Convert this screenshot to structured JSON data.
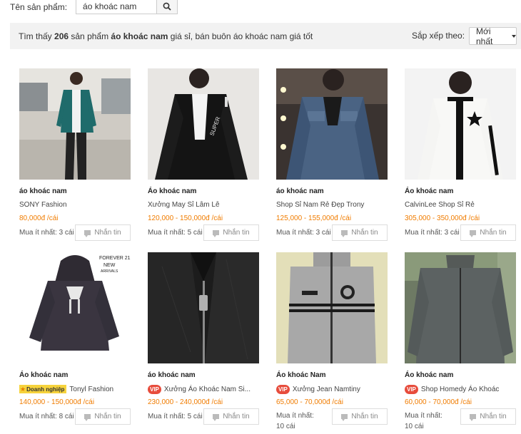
{
  "search": {
    "label": "Tên sản phẩm:",
    "value": "áo khoác nam"
  },
  "result": {
    "prefix": "Tìm thấy ",
    "count": "206",
    "middle": " sản phẩm ",
    "keyword": "áo khoác nam",
    "suffix": " giá sỉ, bán buôn áo khoác nam giá tốt"
  },
  "sort": {
    "label": "Sắp xếp theo:",
    "selected": "Mới nhất"
  },
  "message_label": "Nhắn tin",
  "products": [
    {
      "title": "áo khoác nam",
      "shop": "SONY Fashion",
      "price": "80,000đ",
      "unit": " /cái",
      "min": "Mua ít nhất: 3 cái",
      "colors": {
        "bg": "#c9c4bb",
        "coat": "#1f6b6b"
      }
    },
    {
      "title": "Áo khoác nam",
      "shop": "Xưởng May Sỉ Lâm Lê",
      "price": "120,000 - 150,000đ",
      "unit": " /cái",
      "min": "Mua ít nhất: 5 cái"
    },
    {
      "title": "áo khoác nam",
      "shop": "Shop Sỉ Nam Rẻ Đẹp Trony",
      "price": "125,000 - 155,000đ",
      "unit": " /cái",
      "min": "Mua ít nhất: 3 cái"
    },
    {
      "title": "Áo khoác nam",
      "shop": "CalvinLee Shop Sỉ Rẻ",
      "price": "305,000 - 350,000đ",
      "unit": " /cái",
      "min": "Mua ít nhất: 3 cái"
    },
    {
      "title": "Áo khoác nam",
      "badge": "Doanh nghiệp",
      "shop": "Tonyl Fashion",
      "price": "140,000 - 150,000đ",
      "unit": " /cái",
      "min": "Mua ít nhất: 8 cái",
      "img_text": "FOREVER 21 NEW ARRIVALS"
    },
    {
      "title": "áo khoác nam",
      "badge": "VIP",
      "shop": "Xưởng Áo Khoác Nam Si...",
      "price": "230,000 - 240,000đ",
      "unit": " /cái",
      "min": "Mua ít nhất: 5 cái"
    },
    {
      "title": "Áo khoác Nam",
      "badge": "VIP",
      "shop": "Xưởng Jean Namtiny",
      "price": "65,000 - 70,000đ",
      "unit": " /cái",
      "min": "Mua ít nhất: 10 cái"
    },
    {
      "title": "Áo khoác nam",
      "badge": "VIP",
      "shop": "Shop Homedy Áo Khoác",
      "price": "60,000 - 70,000đ",
      "unit": " /cái",
      "min": "Mua ít nhất: 10 cái"
    }
  ]
}
